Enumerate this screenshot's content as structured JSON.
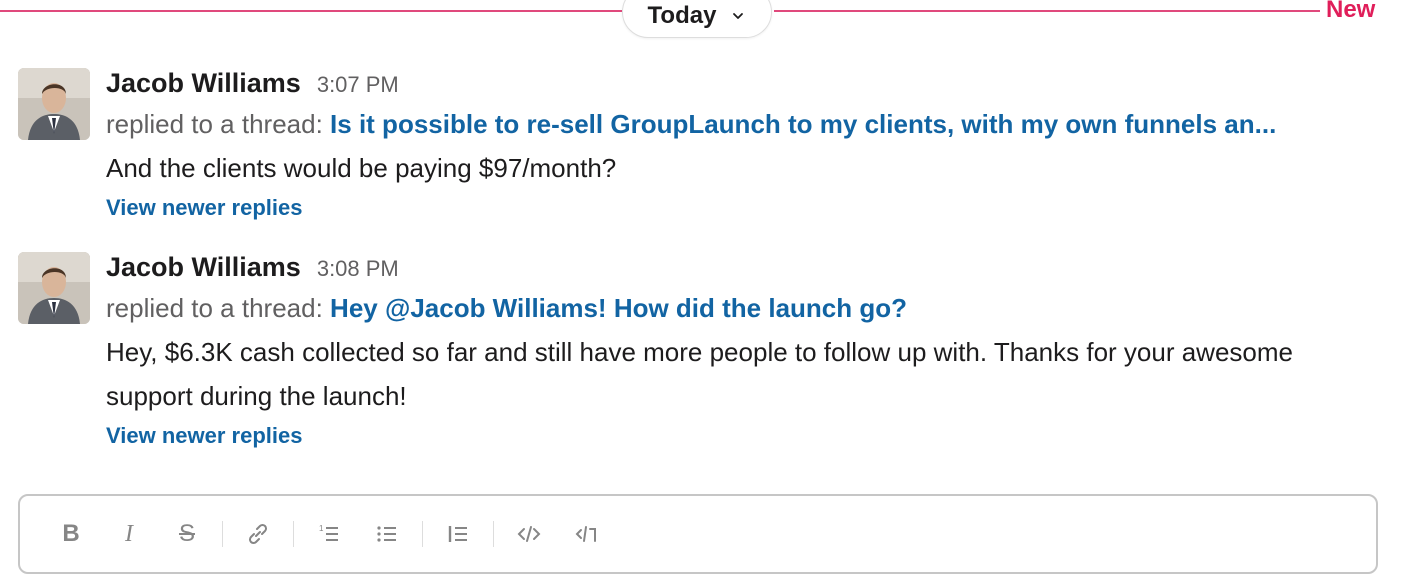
{
  "divider": {
    "day_label": "Today",
    "new_label": "New",
    "accent_color": "#e01e5a"
  },
  "messages": [
    {
      "author": "Jacob Williams",
      "time": "3:07 PM",
      "reply_prefix": "replied to a thread:",
      "thread_title": "Is it possible to re-sell GroupLaunch to my clients, with my own funnels an...",
      "text": "And the clients would be paying $97/month?",
      "view_replies": "View newer replies"
    },
    {
      "author": "Jacob Williams",
      "time": "3:08 PM",
      "reply_prefix": "replied to a thread:",
      "thread_title": "Hey @Jacob Williams! How did the launch go?",
      "text": "Hey, $6.3K cash collected so far and still have more people to follow up with. Thanks for your awesome support during the launch!",
      "view_replies": "View newer replies"
    }
  ],
  "composer": {
    "toolbar": {
      "bold": "B",
      "italic": "I",
      "strike": "S",
      "icons": [
        "link-icon",
        "ordered-list-icon",
        "bulleted-list-icon",
        "blockquote-icon",
        "code-icon",
        "code-block-icon"
      ]
    }
  },
  "colors": {
    "link": "#1264a3",
    "muted": "#616061",
    "text": "#1d1c1d",
    "new_line": "#e0497c"
  }
}
